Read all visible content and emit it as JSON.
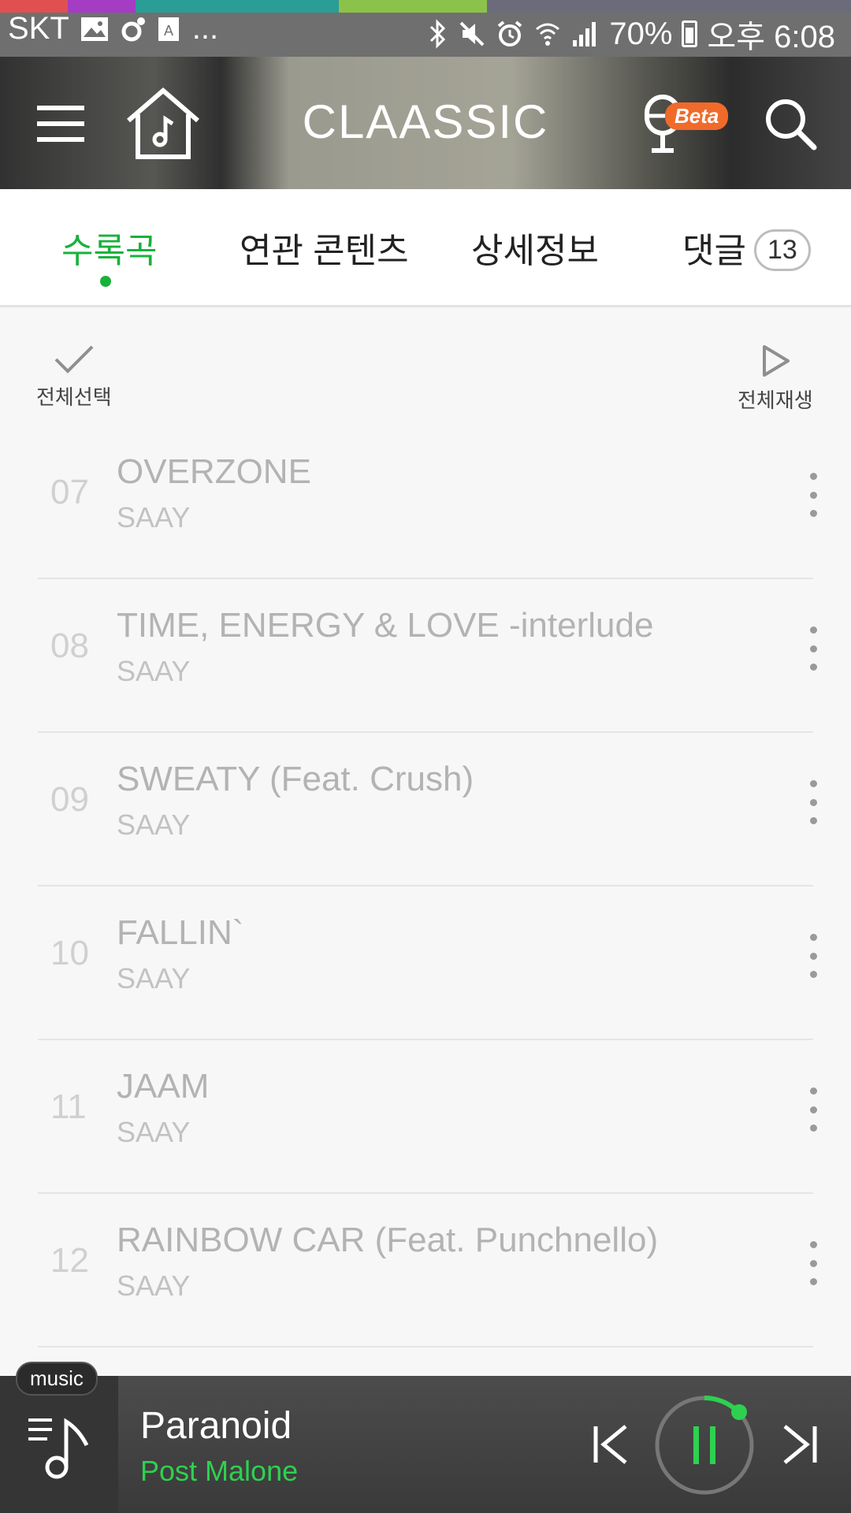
{
  "status_bar": {
    "carrier": "SKT",
    "more": "...",
    "battery": "70%",
    "time": "오후 6:08"
  },
  "header": {
    "title": "CLAASSIC",
    "beta_badge": "Beta",
    "icons": [
      "menu-icon",
      "home-music-icon",
      "microphone-icon",
      "search-icon"
    ]
  },
  "tabs": [
    {
      "label": "수록곡",
      "active": true
    },
    {
      "label": "연관 콘텐츠",
      "active": false
    },
    {
      "label": "상세정보",
      "active": false
    },
    {
      "label": "댓글",
      "active": false,
      "count": "13"
    }
  ],
  "actions": {
    "select_all": "전체선택",
    "play_all": "전체재생"
  },
  "tracks": [
    {
      "num": "07",
      "title": "OVERZONE",
      "artist": "SAAY"
    },
    {
      "num": "08",
      "title": "TIME, ENERGY & LOVE -interlude",
      "artist": "SAAY"
    },
    {
      "num": "09",
      "title": "SWEATY (Feat. Crush)",
      "artist": "SAAY"
    },
    {
      "num": "10",
      "title": "FALLIN`",
      "artist": "SAAY"
    },
    {
      "num": "11",
      "title": "JAAM",
      "artist": "SAAY"
    },
    {
      "num": "12",
      "title": "RAINBOW CAR (Feat. Punchnello)",
      "artist": "SAAY"
    }
  ],
  "player": {
    "tag": "music",
    "title": "Paranoid",
    "artist": "Post Malone",
    "state": "playing",
    "accent": "#2ed14f"
  }
}
